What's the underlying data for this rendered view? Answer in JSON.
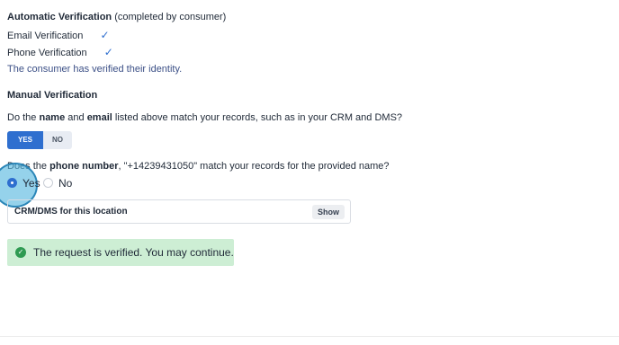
{
  "auto_verification": {
    "title": "Automatic Verification",
    "note": "(completed by consumer)",
    "email_label": "Email Verification",
    "phone_label": "Phone Verification",
    "check_icon": "check-icon",
    "status": "The consumer has verified their identity."
  },
  "manual_verification": {
    "title": "Manual Verification",
    "q1": {
      "prefix": "Do the ",
      "bold1": "name",
      "mid": " and ",
      "bold2": "email",
      "suffix": " listed above match your records, such as in your CRM and DMS?"
    },
    "toggle": {
      "yes": "YES",
      "no": "NO",
      "selected": "YES"
    },
    "q2": {
      "prefix": "Does the ",
      "bold": "phone number",
      "suffix": ", \"+14239431050\" match your records for the provided name?"
    },
    "radio": {
      "yes": "Yes",
      "no": "No",
      "selected": "Yes"
    }
  },
  "crm": {
    "title": "CRM/DMS for this location",
    "button": "Show"
  },
  "alert": {
    "icon": "check-circle-icon",
    "text": "The request is verified. You may continue."
  },
  "colors": {
    "accent": "#2f6fcf",
    "success_bg": "#cdeed4",
    "success_icon": "#2f9a52",
    "highlight": "#54b7de"
  }
}
